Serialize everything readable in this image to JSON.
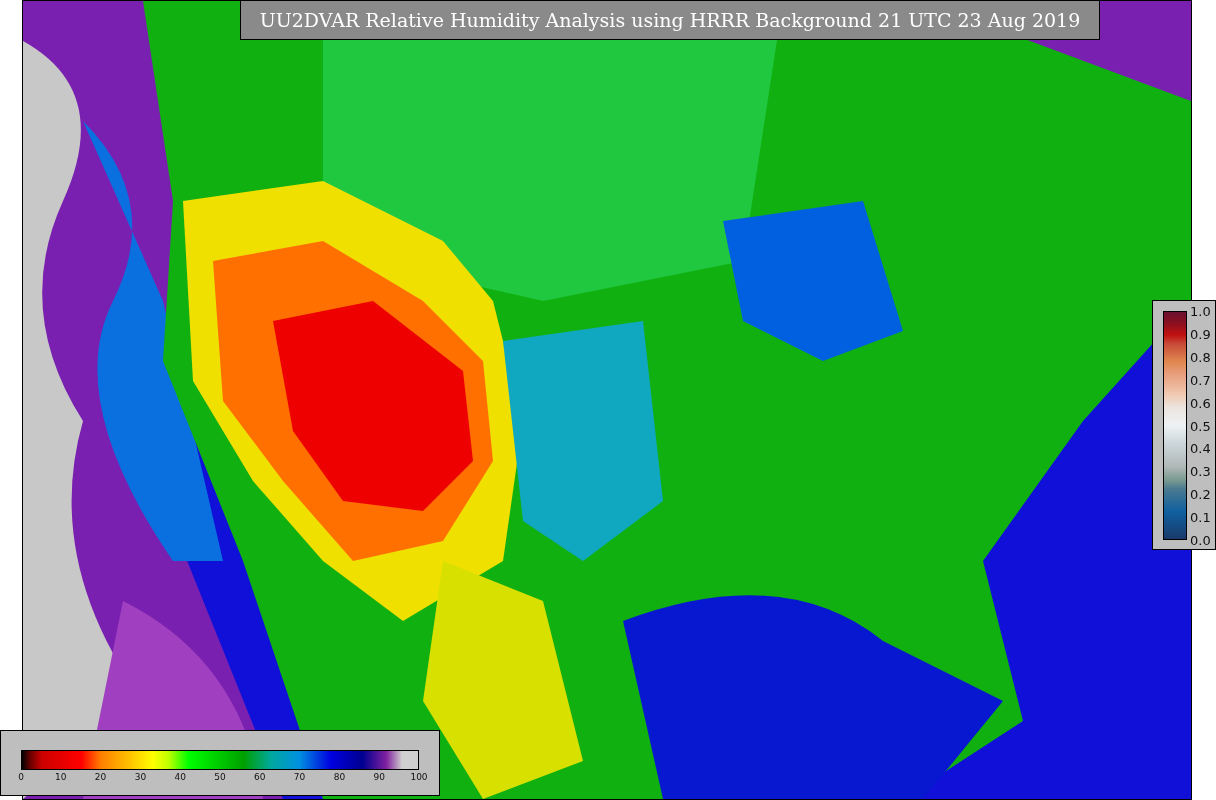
{
  "title": "UU2DVAR Relative Humidity Analysis using HRRR Background 21 UTC 23 Aug 2019",
  "humidity_colorbar": {
    "ticks": [
      "0",
      "10",
      "20",
      "30",
      "40",
      "50",
      "60",
      "70",
      "80",
      "90",
      "100"
    ]
  },
  "observation_colorbar": {
    "ticks": [
      "1.0",
      "0.9",
      "0.8",
      "0.7",
      "0.6",
      "0.5",
      "0.4",
      "0.3",
      "0.2",
      "0.1",
      "0.0"
    ]
  }
}
